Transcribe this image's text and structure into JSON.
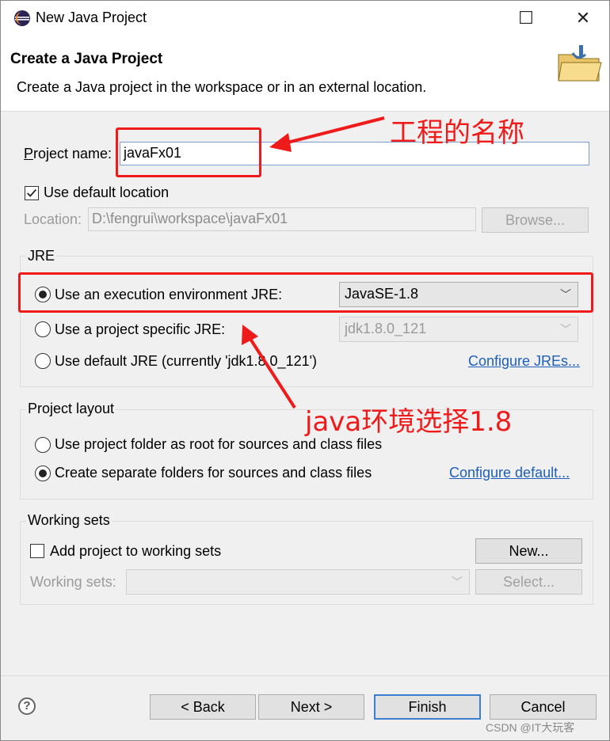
{
  "window": {
    "title": "New Java Project"
  },
  "banner": {
    "title": "Create a Java Project",
    "description": "Create a Java project in the workspace or in an external location."
  },
  "project": {
    "name_label": "Project name:",
    "name_value": "javaFx01",
    "use_default_location_label": "Use default location",
    "use_default_location_checked": true,
    "location_label": "Location:",
    "location_value": "D:\\fengrui\\workspace\\javaFx01",
    "browse_label": "Browse..."
  },
  "jre": {
    "group_label": "JRE",
    "opt_exec_env": "Use an execution environment JRE:",
    "exec_env_value": "JavaSE-1.8",
    "opt_project_specific": "Use a project specific JRE:",
    "project_specific_value": "jdk1.8.0_121",
    "opt_default": "Use default JRE (currently 'jdk1.8.0_121')",
    "configure_link": "Configure JREs...",
    "selected": "exec_env"
  },
  "layout": {
    "group_label": "Project layout",
    "opt_root": "Use project folder as root for sources and class files",
    "opt_separate": "Create separate folders for sources and class files",
    "configure_link": "Configure default...",
    "selected": "separate"
  },
  "working_sets": {
    "group_label": "Working sets",
    "add_label": "Add project to working sets",
    "add_checked": false,
    "new_label": "New...",
    "sets_label": "Working sets:",
    "select_label": "Select..."
  },
  "buttons": {
    "back": "< Back",
    "next": "Next >",
    "finish": "Finish",
    "cancel": "Cancel"
  },
  "annotations": {
    "name_note": "工程的名称",
    "jre_note": "java环境选择1.8",
    "color": "#ef1b1b"
  },
  "watermark": "CSDN @IT大玩客"
}
